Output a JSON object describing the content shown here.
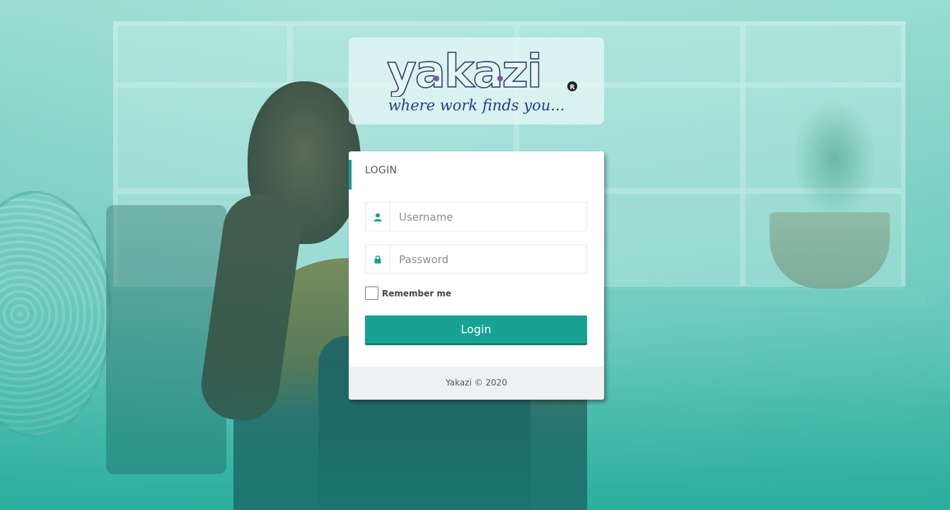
{
  "brand": {
    "wordmark": "yakazi",
    "registered_mark": "R",
    "tagline": "where work finds you..."
  },
  "login": {
    "title": "LOGIN",
    "username_placeholder": "Username",
    "password_placeholder": "Password",
    "remember_label": "Remember me",
    "remember_checked": false,
    "submit_label": "Login",
    "footer_text": "Yakazi © 2020"
  },
  "icons": {
    "username": "user-icon",
    "password": "lock-icon"
  },
  "colors": {
    "accent": "#17a293",
    "tagline": "#1f3f8f",
    "wordmark_outline": "#2a3f6e"
  }
}
